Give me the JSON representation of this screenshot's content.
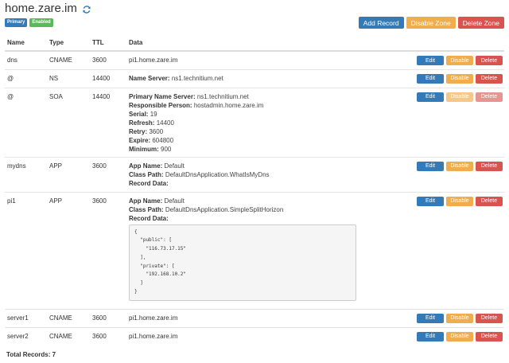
{
  "zone": {
    "title": "home.zare.im",
    "refresh_icon": "refresh-icon",
    "badges": {
      "primary": "Primary",
      "enabled": "Enabled"
    }
  },
  "toolbar": {
    "add_record": "Add Record",
    "disable_zone": "Disable Zone",
    "delete_zone": "Delete Zone"
  },
  "table": {
    "headers": {
      "name": "Name",
      "type": "Type",
      "ttl": "TTL",
      "data": "Data"
    },
    "buttons": {
      "edit": "Edit",
      "disable": "Disable",
      "delete": "Delete"
    },
    "labels": {
      "name_server": "Name Server:",
      "primary_name_server": "Primary Name Server:",
      "responsible_person": "Responsible Person:",
      "serial": "Serial:",
      "refresh": "Refresh:",
      "retry": "Retry:",
      "expire": "Expire:",
      "minimum": "Minimum:",
      "app_name": "App Name:",
      "class_path": "Class Path:",
      "record_data": "Record Data:"
    },
    "rows": [
      {
        "name": "dns",
        "type": "CNAME",
        "ttl": "3600",
        "data": "pi1.home.zare.im"
      },
      {
        "name": "@",
        "type": "NS",
        "ttl": "14400",
        "name_server": "ns1.technitium.net"
      },
      {
        "name": "@",
        "type": "SOA",
        "ttl": "14400",
        "primary_name_server": "ns1.technitium.net",
        "responsible_person": "hostadmin.home.zare.im",
        "serial": "19",
        "refresh": "14400",
        "retry": "3600",
        "expire": "604800",
        "minimum": "900"
      },
      {
        "name": "mydns",
        "type": "APP",
        "ttl": "3600",
        "app_name": "Default",
        "class_path": "DefaultDnsApplication.WhatIsMyDns",
        "record_data": ""
      },
      {
        "name": "pi1",
        "type": "APP",
        "ttl": "3600",
        "app_name": "Default",
        "class_path": "DefaultDnsApplication.SimpleSplitHorizon",
        "record_data": "{\n  \"public\": [\n    \"116.73.17.15\"\n  ],\n  \"private\": [\n    \"192.168.10.2\"\n  ]\n}"
      },
      {
        "name": "server1",
        "type": "CNAME",
        "ttl": "3600",
        "data": "pi1.home.zare.im"
      },
      {
        "name": "server2",
        "type": "CNAME",
        "ttl": "3600",
        "data": "pi1.home.zare.im"
      }
    ]
  },
  "footer": {
    "total": "Total Records: 7"
  },
  "colors": {
    "primary": "#337ab7",
    "success": "#5cb85c",
    "warning": "#f0ad4e",
    "danger": "#d9534f"
  }
}
